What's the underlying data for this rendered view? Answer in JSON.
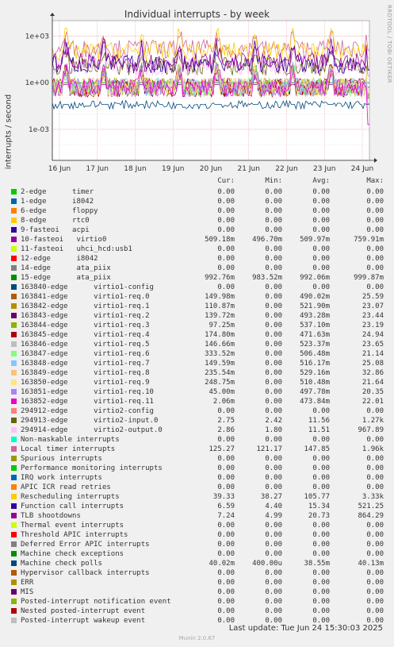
{
  "title": "Individual interrupts - by week",
  "side_label": "RRDTOOL / TOBI OETIKER",
  "footer": {
    "last_update": "Last update: Tue Jun 24 15:30:03 2025",
    "munin_version": "Munin 2.0.67"
  },
  "legend_headers": [
    "Cur:",
    "Min:",
    "Avg:",
    "Max:"
  ],
  "chart_data": {
    "type": "line",
    "title": "Individual interrupts - by week",
    "ylabel": "interrupts / second",
    "yscale": "log",
    "ylim": [
      1e-05,
      10000
    ],
    "yticks": [
      0.001,
      1,
      1000
    ],
    "ytick_labels": [
      "1e-03",
      "1e+00",
      "1e+03"
    ],
    "x_tick_labels": [
      "16 Jun",
      "17 Jun",
      "18 Jun",
      "19 Jun",
      "20 Jun",
      "21 Jun",
      "22 Jun",
      "23 Jun",
      "24 Jun"
    ],
    "grid": true,
    "series": [
      {
        "name": "2-edge      timer",
        "color": "#00cc00",
        "cur": "0.00",
        "min": "0.00",
        "avg": "0.00",
        "max": "0.00"
      },
      {
        "name": "1-edge      i8042",
        "color": "#0066b3",
        "cur": "0.00",
        "min": "0.00",
        "avg": "0.00",
        "max": "0.00"
      },
      {
        "name": "6-edge      floppy",
        "color": "#ff8000",
        "cur": "0.00",
        "min": "0.00",
        "avg": "0.00",
        "max": "0.00"
      },
      {
        "name": "8-edge      rtc0",
        "color": "#ffcc00",
        "cur": "0.00",
        "min": "0.00",
        "avg": "0.00",
        "max": "0.00"
      },
      {
        "name": "9-fasteoi   acpi",
        "color": "#330099",
        "cur": "0.00",
        "min": "0.00",
        "avg": "0.00",
        "max": "0.00"
      },
      {
        "name": "10-fasteoi   virtio0",
        "color": "#990099",
        "cur": "509.18m",
        "min": "496.70m",
        "avg": "509.97m",
        "max": "759.91m"
      },
      {
        "name": "11-fasteoi   uhci_hcd:usb1",
        "color": "#ccff00",
        "cur": "0.00",
        "min": "0.00",
        "avg": "0.00",
        "max": "0.00"
      },
      {
        "name": "12-edge      i8042",
        "color": "#ff0000",
        "cur": "0.00",
        "min": "0.00",
        "avg": "0.00",
        "max": "0.00"
      },
      {
        "name": "14-edge      ata_piix",
        "color": "#808080",
        "cur": "0.00",
        "min": "0.00",
        "avg": "0.00",
        "max": "0.00"
      },
      {
        "name": "15-edge      ata_piix",
        "color": "#008f00",
        "cur": "992.76m",
        "min": "983.52m",
        "avg": "992.06m",
        "max": "999.87m"
      },
      {
        "name": "163840-edge      virtio1-config",
        "color": "#00487d",
        "cur": "0.00",
        "min": "0.00",
        "avg": "0.00",
        "max": "0.00"
      },
      {
        "name": "163841-edge      virtio1-req.0",
        "color": "#b35a00",
        "cur": "149.98m",
        "min": "0.00",
        "avg": "490.02m",
        "max": "25.59"
      },
      {
        "name": "163842-edge      virtio1-req.1",
        "color": "#b38f00",
        "cur": "110.87m",
        "min": "0.00",
        "avg": "521.90m",
        "max": "23.07"
      },
      {
        "name": "163843-edge      virtio1-req.2",
        "color": "#6b006b",
        "cur": "139.72m",
        "min": "0.00",
        "avg": "493.28m",
        "max": "23.44"
      },
      {
        "name": "163844-edge      virtio1-req.3",
        "color": "#8fb300",
        "cur": "97.25m",
        "min": "0.00",
        "avg": "537.10m",
        "max": "23.19"
      },
      {
        "name": "163845-edge      virtio1-req.4",
        "color": "#b30000",
        "cur": "174.80m",
        "min": "0.00",
        "avg": "471.63m",
        "max": "24.94"
      },
      {
        "name": "163846-edge      virtio1-req.5",
        "color": "#bebebe",
        "cur": "146.66m",
        "min": "0.00",
        "avg": "523.37m",
        "max": "23.65"
      },
      {
        "name": "163847-edge      virtio1-req.6",
        "color": "#80ff80",
        "cur": "333.52m",
        "min": "0.00",
        "avg": "506.48m",
        "max": "21.14"
      },
      {
        "name": "163848-edge      virtio1-req.7",
        "color": "#80c9ff",
        "cur": "149.59m",
        "min": "0.00",
        "avg": "516.17m",
        "max": "25.08"
      },
      {
        "name": "163849-edge      virtio1-req.8",
        "color": "#ffc080",
        "cur": "235.54m",
        "min": "0.00",
        "avg": "529.16m",
        "max": "32.86"
      },
      {
        "name": "163850-edge      virtio1-req.9",
        "color": "#ffe680",
        "cur": "248.75m",
        "min": "0.00",
        "avg": "510.48m",
        "max": "21.64"
      },
      {
        "name": "163851-edge      virtio1-req.10",
        "color": "#aa80ff",
        "cur": "45.00m",
        "min": "0.00",
        "avg": "497.78m",
        "max": "20.35"
      },
      {
        "name": "163852-edge      virtio1-req.11",
        "color": "#ee00cc",
        "cur": "2.06m",
        "min": "0.00",
        "avg": "473.84m",
        "max": "22.01"
      },
      {
        "name": "294912-edge      virtio2-config",
        "color": "#ff8080",
        "cur": "0.00",
        "min": "0.00",
        "avg": "0.00",
        "max": "0.00"
      },
      {
        "name": "294913-edge      virtio2-input.0",
        "color": "#666600",
        "cur": "2.75",
        "min": "2.42",
        "avg": "11.56",
        "max": "1.27k"
      },
      {
        "name": "294914-edge      virtio2-output.0",
        "color": "#ffbfff",
        "cur": "2.86",
        "min": "1.80",
        "avg": "11.51",
        "max": "967.89"
      },
      {
        "name": "Non-maskable interrupts",
        "color": "#00ffcc",
        "cur": "0.00",
        "min": "0.00",
        "avg": "0.00",
        "max": "0.00"
      },
      {
        "name": "Local timer interrupts",
        "color": "#cc6699",
        "cur": "125.27",
        "min": "121.17",
        "avg": "147.85",
        "max": "1.96k"
      },
      {
        "name": "Spurious interrupts",
        "color": "#999900",
        "cur": "0.00",
        "min": "0.00",
        "avg": "0.00",
        "max": "0.00"
      },
      {
        "name": "Performance monitoring interrupts",
        "color": "#00cc00",
        "cur": "0.00",
        "min": "0.00",
        "avg": "0.00",
        "max": "0.00"
      },
      {
        "name": "IRQ work interrupts",
        "color": "#0066b3",
        "cur": "0.00",
        "min": "0.00",
        "avg": "0.00",
        "max": "0.00"
      },
      {
        "name": "APIC ICR read retries",
        "color": "#ff8000",
        "cur": "0.00",
        "min": "0.00",
        "avg": "0.00",
        "max": "0.00"
      },
      {
        "name": "Rescheduling interrupts",
        "color": "#ffcc00",
        "cur": "39.33",
        "min": "38.27",
        "avg": "105.77",
        "max": "3.33k"
      },
      {
        "name": "Function call interrupts",
        "color": "#330099",
        "cur": "6.59",
        "min": "4.40",
        "avg": "15.34",
        "max": "521.25"
      },
      {
        "name": "TLB shootdowns",
        "color": "#990099",
        "cur": "7.24",
        "min": "4.99",
        "avg": "20.73",
        "max": "864.29"
      },
      {
        "name": "Thermal event interrupts",
        "color": "#ccff00",
        "cur": "0.00",
        "min": "0.00",
        "avg": "0.00",
        "max": "0.00"
      },
      {
        "name": "Threshold APIC interrupts",
        "color": "#ff0000",
        "cur": "0.00",
        "min": "0.00",
        "avg": "0.00",
        "max": "0.00"
      },
      {
        "name": "Deferred Error APIC interrupts",
        "color": "#808080",
        "cur": "0.00",
        "min": "0.00",
        "avg": "0.00",
        "max": "0.00"
      },
      {
        "name": "Machine check exceptions",
        "color": "#008f00",
        "cur": "0.00",
        "min": "0.00",
        "avg": "0.00",
        "max": "0.00"
      },
      {
        "name": "Machine check polls",
        "color": "#00487d",
        "cur": "40.02m",
        "min": "400.00u",
        "avg": "38.55m",
        "max": "40.13m"
      },
      {
        "name": "Hypervisor callback interrupts",
        "color": "#b35a00",
        "cur": "0.00",
        "min": "0.00",
        "avg": "0.00",
        "max": "0.00"
      },
      {
        "name": "ERR",
        "color": "#b38f00",
        "cur": "0.00",
        "min": "0.00",
        "avg": "0.00",
        "max": "0.00"
      },
      {
        "name": "MIS",
        "color": "#6b006b",
        "cur": "0.00",
        "min": "0.00",
        "avg": "0.00",
        "max": "0.00"
      },
      {
        "name": "Posted-interrupt notification event",
        "color": "#8fb300",
        "cur": "0.00",
        "min": "0.00",
        "avg": "0.00",
        "max": "0.00"
      },
      {
        "name": "Nested posted-interrupt event",
        "color": "#b30000",
        "cur": "0.00",
        "min": "0.00",
        "avg": "0.00",
        "max": "0.00"
      },
      {
        "name": "Posted-interrupt wakeup event",
        "color": "#bebebe",
        "cur": "0.00",
        "min": "0.00",
        "avg": "0.00",
        "max": "0.00"
      }
    ]
  }
}
